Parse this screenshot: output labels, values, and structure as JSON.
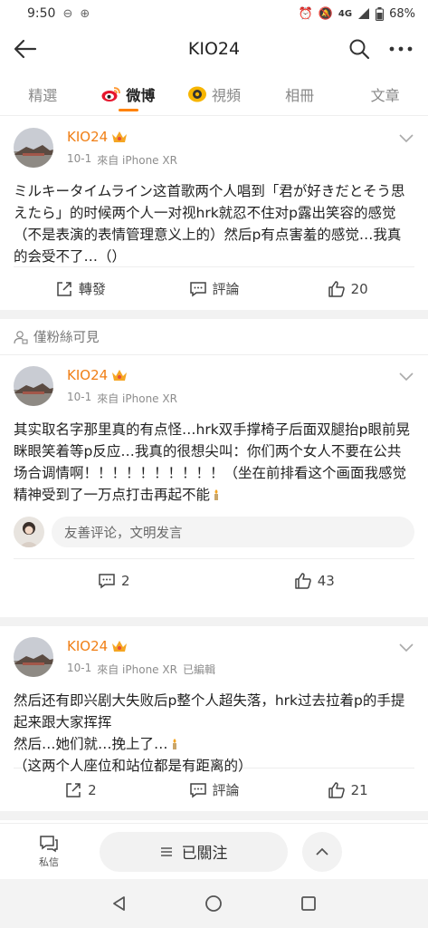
{
  "status_bar": {
    "time": "9:50",
    "network": "4G",
    "battery": "68%"
  },
  "top_nav": {
    "title": "KIO24"
  },
  "tabs": [
    {
      "label": "精選"
    },
    {
      "label": "微博"
    },
    {
      "label": "視頻"
    },
    {
      "label": "相冊"
    },
    {
      "label": "文章"
    }
  ],
  "posts": [
    {
      "username": "KIO24",
      "date": "10-1",
      "source": "來自 iPhone XR",
      "edited": "",
      "text_lines": [
        "ミルキータイムライン这首歌两个人唱到「君が好きだとそう思えたら」的时候两个人一对视hrk就忍不住对p露出笑容的感觉（不是表演的表情管理意义上的）然后p有点害羞的感觉…我真的会受不了…（）"
      ],
      "repost_label": "轉發",
      "comment_label": "評論",
      "like_count": "20"
    },
    {
      "fans_only_label": "僅粉絲可見",
      "username": "KIO24",
      "date": "10-1",
      "source": "來自 iPhone XR",
      "edited": "",
      "text_lines": [
        "其实取名字那里真的有点怪…hrk双手撑椅子后面双腿抬p眼前晃眯眼笑着等p反应…我真的很想尖叫：你们两个女人不要在公共场合调情啊！！！！！！！！！！（坐在前排看这个画面我感觉精神受到了一万点打击再起不能"
      ],
      "comment_placeholder": "友善评论，文明发言",
      "comment_count": "2",
      "like_count": "43"
    },
    {
      "username": "KIO24",
      "date": "10-1",
      "source": "來自 iPhone XR",
      "edited": "已編輯",
      "text_lines": [
        "然后还有即兴剧大失败后p整个人超失落，hrk过去拉着p的手提起来跟大家挥挥",
        "然后…她们就…挽上了…",
        "（这两个人座位和站位都是有距离的）"
      ],
      "repost_count": "2",
      "comment_label": "評論",
      "like_count": "21"
    }
  ],
  "bottom_bar": {
    "message_label": "私信",
    "follow_label": "已關注"
  },
  "colors": {
    "accent": "#ff8200",
    "username": "#f07f16"
  }
}
